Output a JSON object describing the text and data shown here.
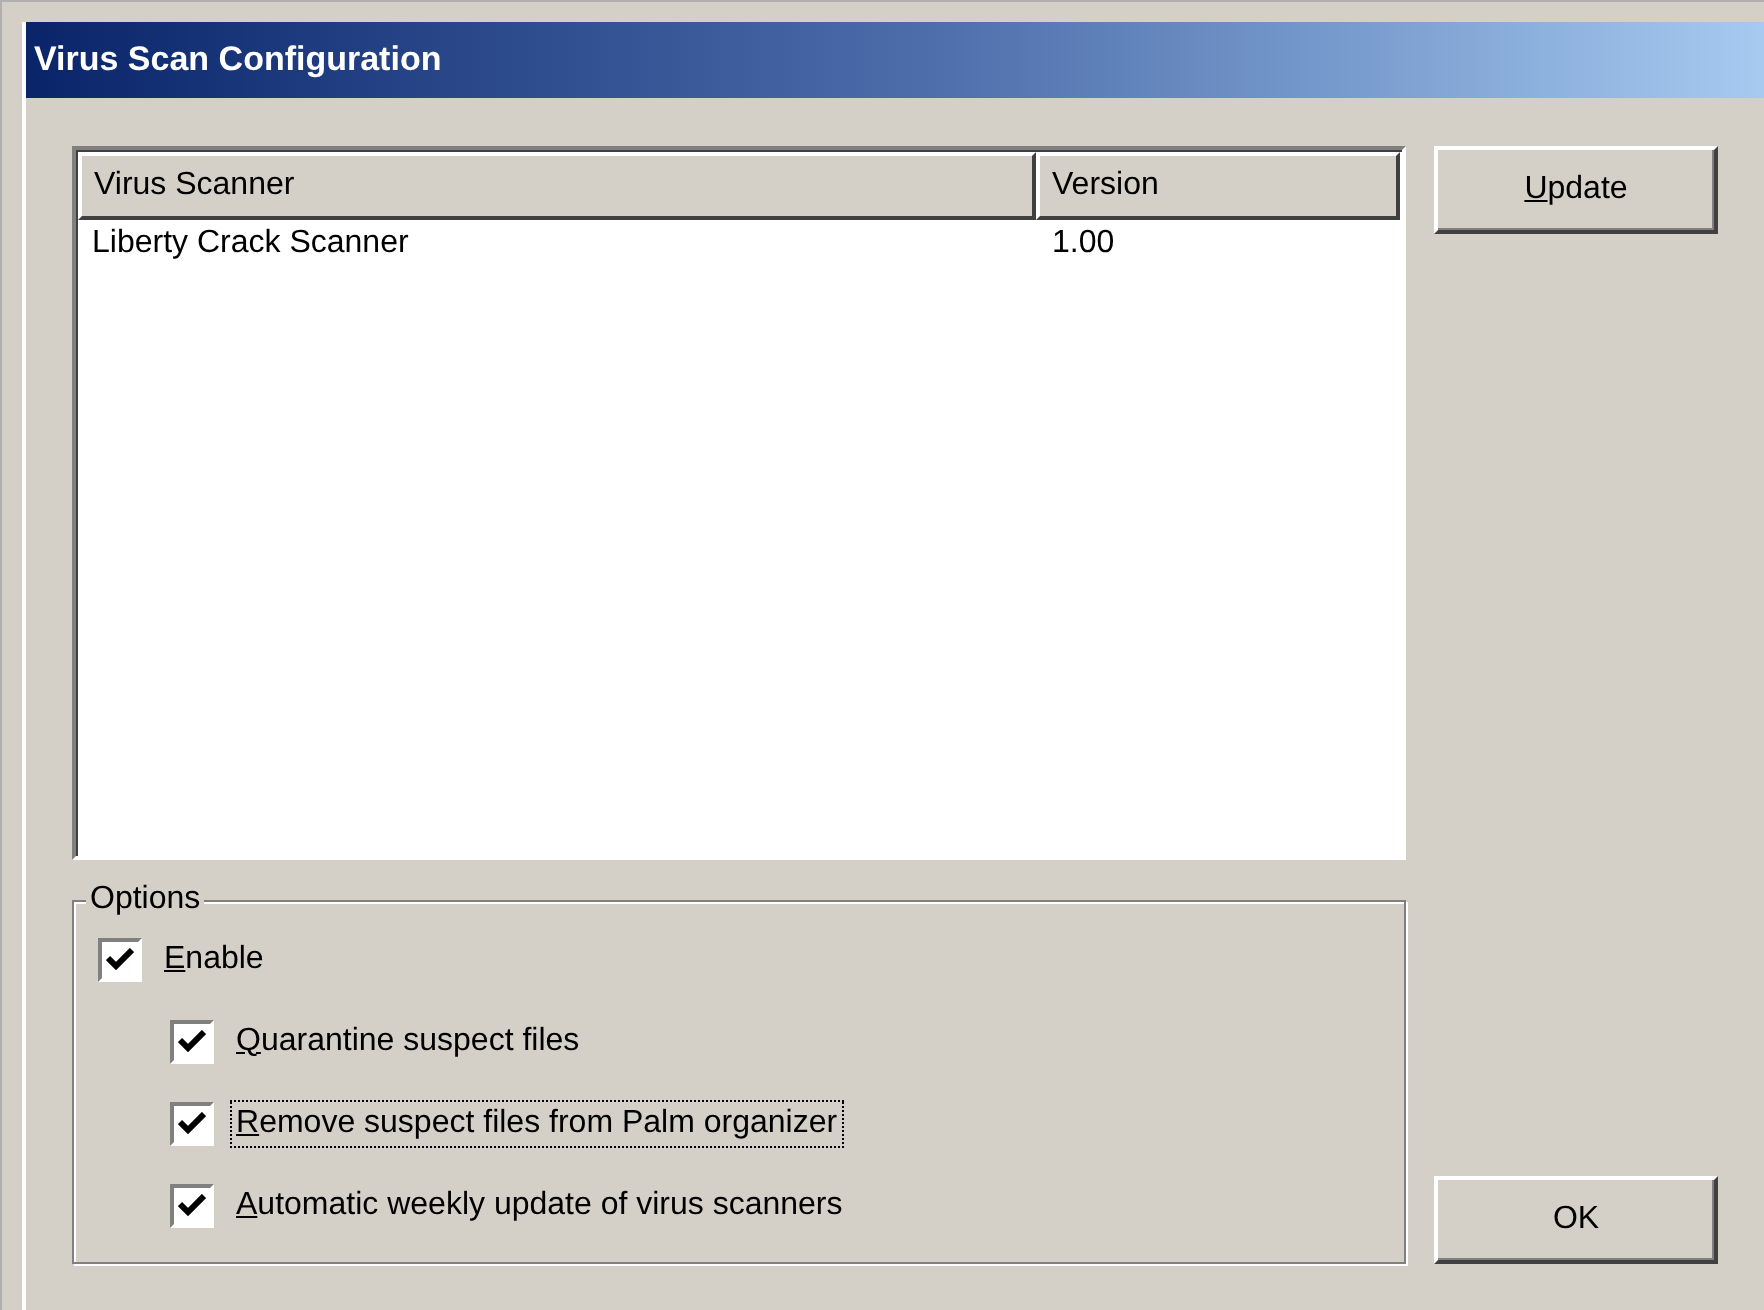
{
  "window": {
    "title": "Virus Scan Configuration"
  },
  "table": {
    "columns": [
      "Virus Scanner",
      "Version"
    ],
    "rows": [
      {
        "cells": [
          "Liberty Crack Scanner",
          "1.00"
        ]
      }
    ]
  },
  "buttons": [
    {
      "label": "Update",
      "mnemonic_first": true
    },
    {
      "label": "OK",
      "mnemonic_first": false
    }
  ],
  "options": {
    "title": "Options",
    "items": [
      {
        "label": "Enable",
        "checked": true,
        "focused": false,
        "children": [
          {
            "label": "Quarantine suspect files",
            "checked": true,
            "focused": false
          },
          {
            "label": "Remove suspect files from Palm organizer",
            "checked": true,
            "focused": true
          },
          {
            "label": "Automatic weekly update of virus scanners",
            "checked": true,
            "focused": false
          }
        ]
      }
    ]
  }
}
